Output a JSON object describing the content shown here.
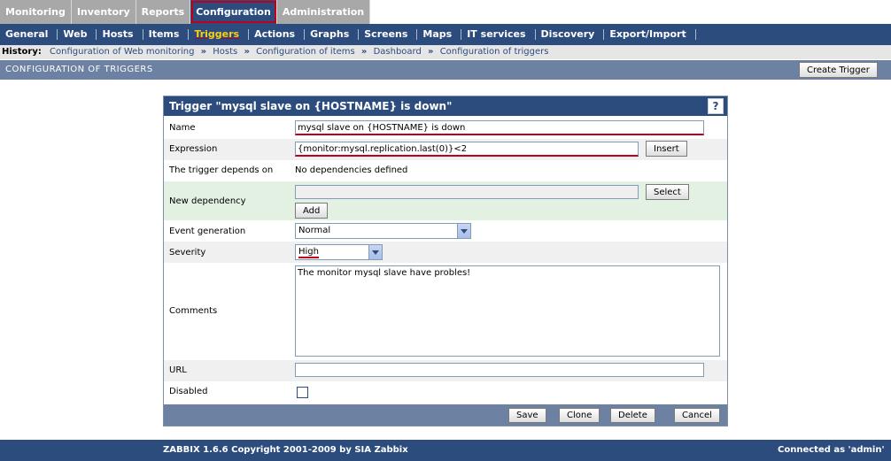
{
  "main_tabs": [
    "Monitoring",
    "Inventory",
    "Reports",
    "Configuration",
    "Administration"
  ],
  "sub_tabs": [
    "General",
    "Web",
    "Hosts",
    "Items",
    "Triggers",
    "Actions",
    "Graphs",
    "Screens",
    "Maps",
    "IT services",
    "Discovery",
    "Export/Import"
  ],
  "history": {
    "label": "History:",
    "crumbs": [
      "Configuration of Web monitoring",
      "Hosts",
      "Configuration of items",
      "Dashboard",
      "Configuration of triggers"
    ]
  },
  "page": {
    "title": "CONFIGURATION OF TRIGGERS",
    "create_label": "Create Trigger"
  },
  "form": {
    "title": "Trigger \"mysql slave on {HOSTNAME} is down\"",
    "help": "?",
    "name_label": "Name",
    "name_value": "mysql slave on {HOSTNAME} is down",
    "expression_label": "Expression",
    "expression_value": "{monitor:mysql.replication.last(0)}<2",
    "insert_label": "Insert",
    "depends_label": "The trigger depends on",
    "depends_value": "No dependencies defined",
    "new_dep_label": "New dependency",
    "select_label": "Select",
    "add_label": "Add",
    "event_label": "Event generation",
    "event_value": "Normal",
    "severity_label": "Severity",
    "severity_value": "High",
    "comments_label": "Comments",
    "comments_value": "The monitor mysql slave have probles!",
    "url_label": "URL",
    "disabled_label": "Disabled",
    "save_label": "Save",
    "clone_label": "Clone",
    "delete_label": "Delete",
    "cancel_label": "Cancel"
  },
  "footer": {
    "copyright": "ZABBIX 1.6.6 Copyright 2001-2009 by  SIA Zabbix",
    "connected": "Connected as 'admin'"
  }
}
